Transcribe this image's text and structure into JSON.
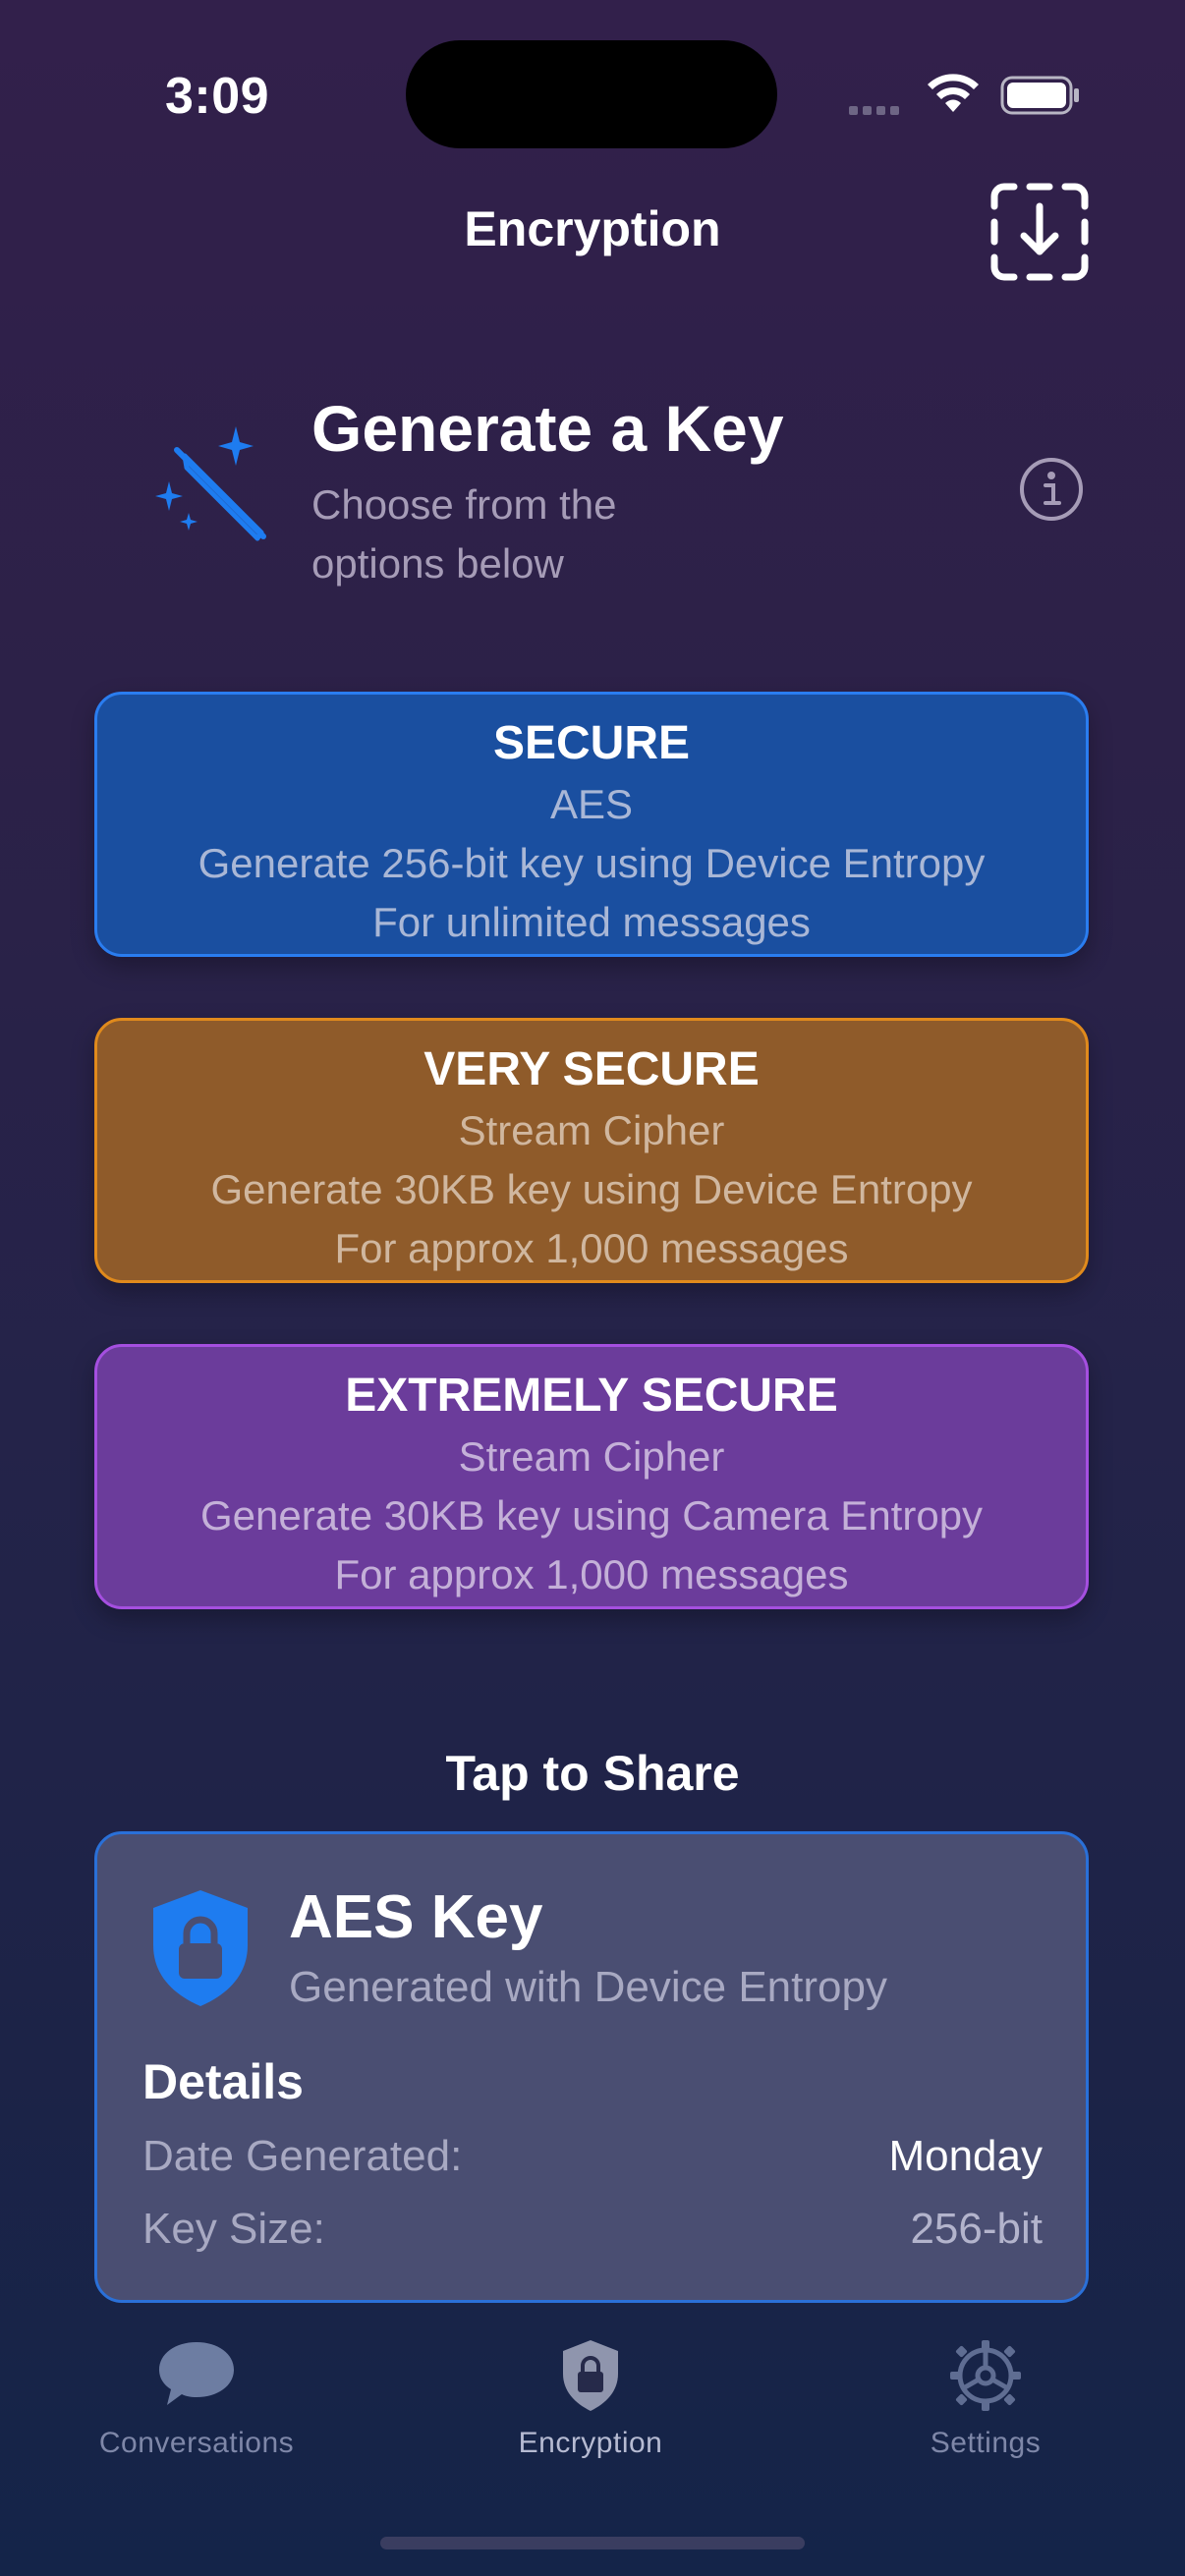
{
  "status_bar": {
    "time": "3:09"
  },
  "nav": {
    "title": "Encryption",
    "import_icon": "square-and-arrow-down-dashed-icon"
  },
  "header": {
    "icon": "wand-and-stars-icon",
    "title": "Generate a Key",
    "subtitle": "Choose from the options below",
    "info_icon": "info-circle-icon"
  },
  "options": [
    {
      "title": "SECURE",
      "cipher": "AES",
      "description": "Generate 256-bit key using Device Entropy",
      "capacity": "For unlimited messages",
      "color": "#1a4fa0"
    },
    {
      "title": "VERY SECURE",
      "cipher": "Stream Cipher",
      "description": "Generate 30KB key using Device Entropy",
      "capacity": "For approx 1,000 messages",
      "color": "#8f5b2a"
    },
    {
      "title": "EXTREMELY SECURE",
      "cipher": "Stream Cipher",
      "description": "Generate 30KB key using Camera Entropy",
      "capacity": "For approx 1,000 messages",
      "color": "#6b3c9b"
    }
  ],
  "share": {
    "heading": "Tap to Share",
    "key": {
      "icon": "lock-shield-icon",
      "title": "AES Key",
      "subtitle": "Generated with Device Entropy",
      "details_heading": "Details",
      "rows": [
        {
          "label": "Date Generated:",
          "value": "Monday"
        },
        {
          "label": "Key Size:",
          "value": "256-bit"
        }
      ]
    }
  },
  "tab_bar": {
    "tabs": [
      {
        "label": "Conversations",
        "icon": "bubble-icon",
        "active": false
      },
      {
        "label": "Encryption",
        "icon": "lock-shield-icon",
        "active": true
      },
      {
        "label": "Settings",
        "icon": "gear-icon",
        "active": false
      }
    ]
  }
}
